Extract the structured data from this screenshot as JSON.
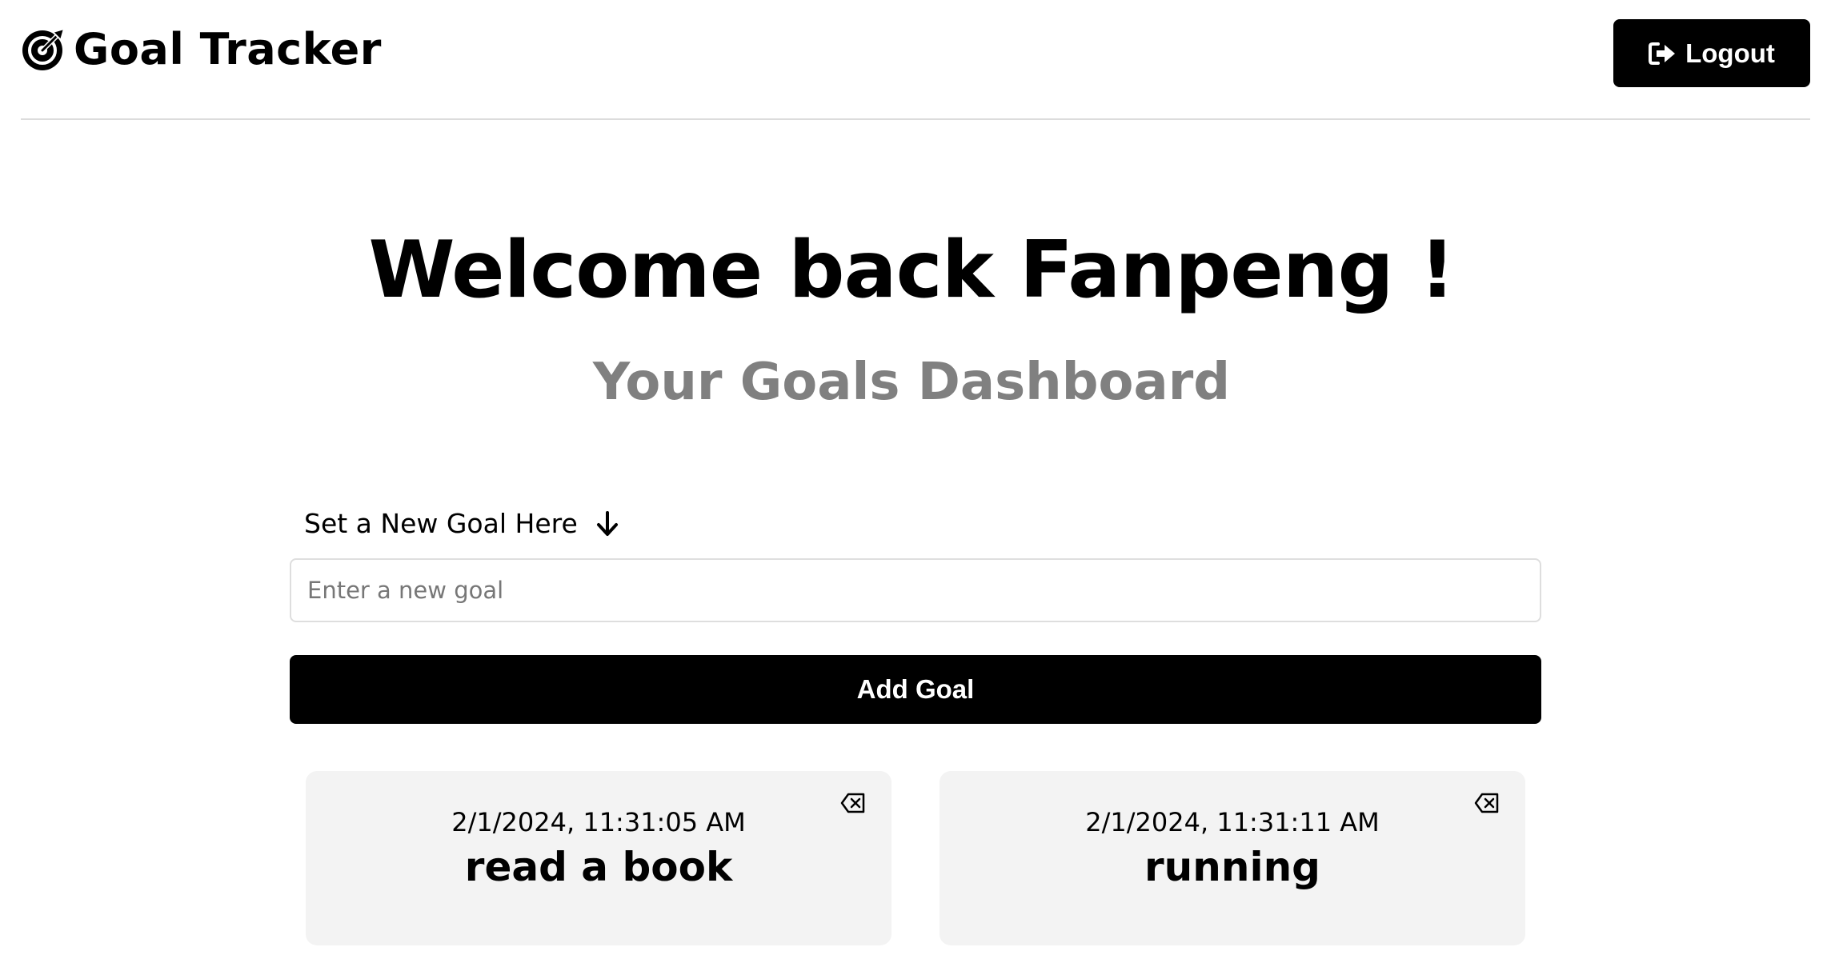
{
  "header": {
    "brand_icon": "bullseye-arrow-icon",
    "brand_title": "Goal Tracker",
    "logout_icon": "logout-arrow-icon",
    "logout_label": "Logout"
  },
  "main": {
    "welcome": "Welcome back Fanpeng !",
    "subtitle": "Your Goals Dashboard"
  },
  "form": {
    "label": "Set a New Goal Here",
    "label_icon": "arrow-down-icon",
    "input_placeholder": "Enter a new goal",
    "input_value": "",
    "submit_label": "Add Goal"
  },
  "goals": [
    {
      "date": "2/1/2024, 11:31:05 AM",
      "text": "read a book",
      "delete_icon": "backspace-delete-icon"
    },
    {
      "date": "2/1/2024, 11:31:11 AM",
      "text": "running",
      "delete_icon": "backspace-delete-icon"
    }
  ],
  "colors": {
    "primary": "#000000",
    "subtitle": "#808080",
    "card_bg": "#f3f3f3",
    "divider": "#dcdcdc"
  }
}
